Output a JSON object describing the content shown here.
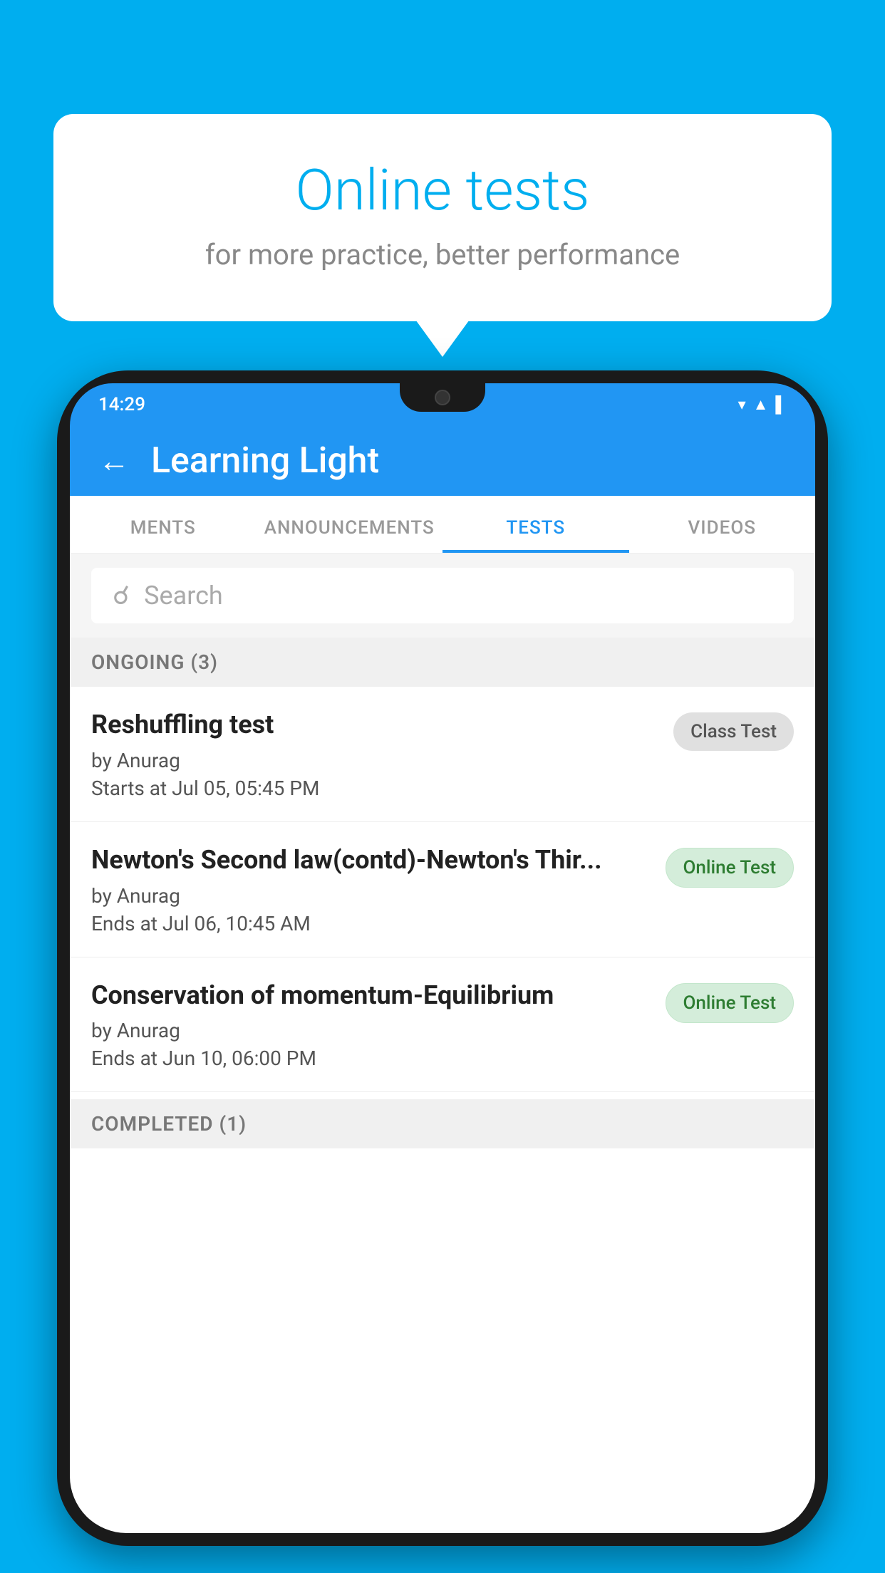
{
  "background_color": "#00AEEF",
  "bubble": {
    "title": "Online tests",
    "subtitle": "for more practice, better performance"
  },
  "phone": {
    "status_time": "14:29",
    "app_title": "Learning Light",
    "back_label": "←",
    "tabs": [
      {
        "id": "ments",
        "label": "MENTS",
        "active": false
      },
      {
        "id": "announcements",
        "label": "ANNOUNCEMENTS",
        "active": false
      },
      {
        "id": "tests",
        "label": "TESTS",
        "active": true
      },
      {
        "id": "videos",
        "label": "VIDEOS",
        "active": false
      }
    ],
    "search": {
      "placeholder": "Search"
    },
    "ongoing_section": "ONGOING (3)",
    "tests": [
      {
        "id": "reshuffling",
        "name": "Reshuffling test",
        "author": "by Anurag",
        "date": "Starts at  Jul 05, 05:45 PM",
        "badge": "Class Test",
        "badge_type": "gray"
      },
      {
        "id": "newtons",
        "name": "Newton's Second law(contd)-Newton's Thir...",
        "author": "by Anurag",
        "date": "Ends at  Jul 06, 10:45 AM",
        "badge": "Online Test",
        "badge_type": "green"
      },
      {
        "id": "conservation",
        "name": "Conservation of momentum-Equilibrium",
        "author": "by Anurag",
        "date": "Ends at  Jun 10, 06:00 PM",
        "badge": "Online Test",
        "badge_type": "green"
      }
    ],
    "completed_section": "COMPLETED (1)"
  }
}
